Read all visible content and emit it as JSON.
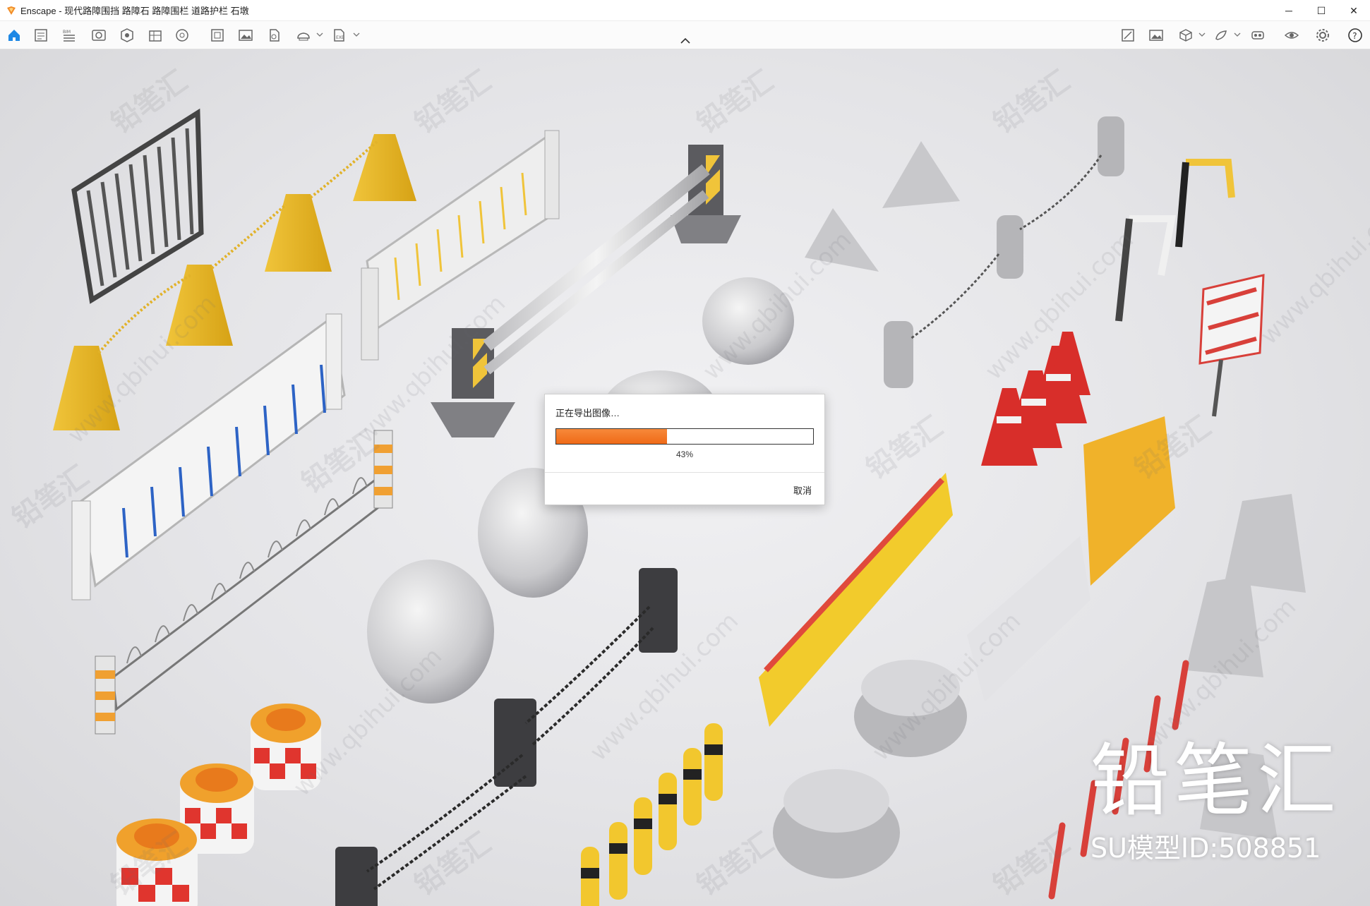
{
  "window": {
    "app_name": "Enscape",
    "title": "Enscape - 现代路障围挡 路障石 路障围栏 道路护栏 石墩",
    "controls": {
      "minimize": "─",
      "maximize": "☐",
      "close": "✕"
    }
  },
  "toolbar": {
    "left_icons": [
      "home-icon",
      "asset-library-icon",
      "batch-render-icon",
      "render-screenshot-icon",
      "panorama-icon",
      "bim-icon",
      "material-editor-icon",
      "view-management-icon",
      "video-editor-icon",
      "atmosphere-icon",
      "upload-icon",
      "export-icon"
    ],
    "right_icons": [
      "synchronize-views-icon",
      "capture-icon",
      "sync-selection-icon",
      "live-update-icon",
      "vr-headset-icon",
      "visual-settings-icon",
      "general-settings-icon",
      "help-icon"
    ],
    "accent_color": "#1e88e5"
  },
  "dialog": {
    "title": "正在导出图像…",
    "progress_percent": 43,
    "progress_label": "43%",
    "cancel_label": "取消",
    "progress_color": "#f07a24"
  },
  "watermark": {
    "text": "铅笔汇",
    "url": "www.qbihui.com",
    "brand_name": "铅笔汇",
    "model_id": "SU模型ID:508851"
  }
}
